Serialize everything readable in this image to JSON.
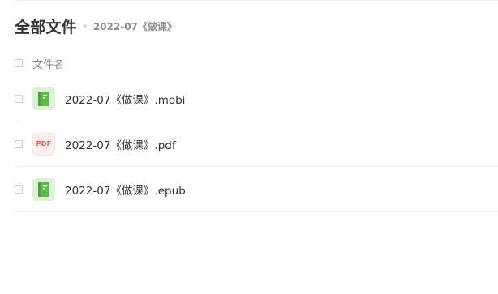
{
  "header": {
    "title": "全部文件",
    "breadcrumb": "2022-07《做课》"
  },
  "list": {
    "column_name": "文件名",
    "rows": [
      {
        "name": "2022-07《做课》.mobi",
        "icon": "book-icon"
      },
      {
        "name": "2022-07《做课》.pdf",
        "icon": "pdf-icon",
        "icon_text": "PDF"
      },
      {
        "name": "2022-07《做课》.epub",
        "icon": "book-icon"
      }
    ]
  },
  "colors": {
    "book_icon_bg": "#dff2d8",
    "book_icon_fg": "#62b84a",
    "pdf_icon_text": "#f05a5a"
  }
}
